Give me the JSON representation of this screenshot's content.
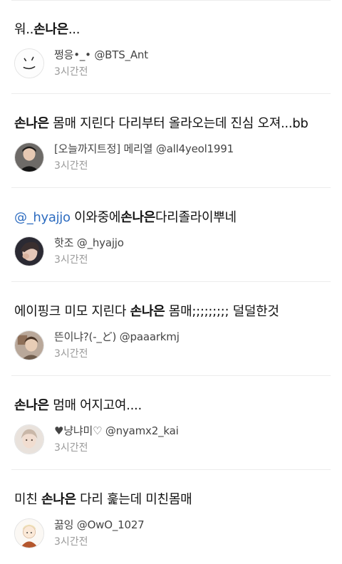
{
  "tweets": [
    {
      "text_prefix": "워..",
      "text_bold": "손나은",
      "text_suffix": "...",
      "author": "쩡응•_• @BTS_Ant",
      "time": "3시간전",
      "avatar_icon": "smiley-face-icon"
    },
    {
      "text_prefix": "",
      "text_bold": "손나은",
      "text_suffix": " 몸매 지린다 다리부터 올라오는데 진심 오져...bb",
      "author": "[오늘까지트정] 메리열 @all4yeol1991",
      "time": "3시간전",
      "avatar_icon": "person-photo-icon"
    },
    {
      "mention": "@_hyajjo",
      "text_prefix": " 이와중에",
      "text_bold": "손나은",
      "text_suffix": "다리졸라이뿌네",
      "author": "핫조 @_hyajjo",
      "time": "3시간전",
      "avatar_icon": "person-photo-icon"
    },
    {
      "text_prefix": "에이핑크 미모 지린다 ",
      "text_bold": "손나은",
      "text_suffix": " 몸매;;;;;;;;; 덜덜한것",
      "author": "뜬이냐?(-_ど) @paaarkmj",
      "time": "3시간전",
      "avatar_icon": "person-photo-icon"
    },
    {
      "text_prefix": "",
      "text_bold": "손나은",
      "text_suffix": " 멈매 어지고여....",
      "author": "♥냥냐미♡ @nyamx2_kai",
      "time": "3시간전",
      "avatar_icon": "person-photo-icon"
    },
    {
      "text_prefix": "미친 ",
      "text_bold": "손나은",
      "text_suffix": " 다리 훑는데 미친몸매",
      "author": "끎잉 @OwO_1027",
      "time": "3시간전",
      "avatar_icon": "cartoon-avatar-icon"
    }
  ]
}
